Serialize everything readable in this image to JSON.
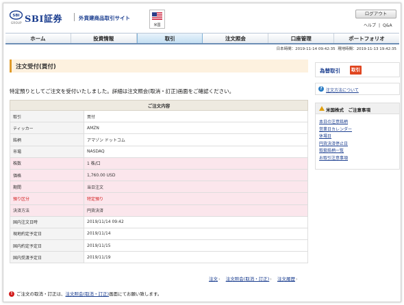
{
  "header": {
    "logo_text": "SBI証券",
    "logo_group": "GROUP",
    "logo_mark": "SBI",
    "site_name": "外貨建商品取引サイト",
    "flag_label": "米国",
    "logout": "ログアウト",
    "help": "ヘルプ",
    "help_sep": "|",
    "qa": "Q&A"
  },
  "nav": {
    "items": [
      "ホーム",
      "投資情報",
      "取引",
      "注文照会",
      "口座管理",
      "ポートフォリオ"
    ],
    "active_index": 2
  },
  "time": {
    "jp": "日本時間：2019-11-14 09:42:35",
    "local": "現地時間：2019-11-13 19:42:35"
  },
  "page": {
    "title": "注文受付(買付)",
    "message": "特定預りとしてご注文を受付いたしました。詳細は注文照会(取消・訂正)画面をご確認ください。"
  },
  "order": {
    "header": "ご注文内容",
    "rows": [
      {
        "label": "取引",
        "value": "買付"
      },
      {
        "label": "ティッカー",
        "value": "AMZN"
      },
      {
        "label": "銘柄",
        "value": "アマゾン ドットコム"
      },
      {
        "label": "市場",
        "value": "NASDAQ"
      },
      {
        "label": "株数",
        "value": "1 株/口"
      },
      {
        "label": "価格",
        "value": "1,760.00 USD"
      },
      {
        "label": "期間",
        "value": "当日注文"
      },
      {
        "label": "預り区分",
        "value": "特定預り"
      },
      {
        "label": "決済方法",
        "value": "円貨決済"
      },
      {
        "label": "国内注文日時",
        "value": "2019/11/14 09:42"
      },
      {
        "label": "現地約定予定日",
        "value": "2019/11/14"
      },
      {
        "label": "国内約定予定日",
        "value": "2019/11/15"
      },
      {
        "label": "国内受渡予定日",
        "value": "2019/11/19"
      }
    ]
  },
  "sidebar": {
    "trade_label": "為替取引",
    "trade_button": "取引",
    "help_link": "注文方法について",
    "caution_title": "米国株式　ご注意事項",
    "caution_links": [
      "本日の注意銘柄",
      "営業日カレンダー",
      "休場日",
      "円貨決済停止日",
      "取扱銘柄一覧",
      "お取引注意事項"
    ]
  },
  "bottom_links": [
    {
      "label": "注文"
    },
    {
      "label": "注文照会(取消・訂正)"
    },
    {
      "label": "注文履歴"
    }
  ],
  "footer": {
    "icon": "!",
    "before": "ご注文の取消・訂正は、",
    "link": "注文照会(取消・訂正)",
    "after": "画面にてお願い致します。"
  },
  "colors": {
    "brand": "#1a3d8f",
    "accent_orange": "#e09b2a",
    "trade_button": "#e0451f",
    "highlight_row": "#fbe6ec",
    "alert_text": "#d21b1b"
  }
}
